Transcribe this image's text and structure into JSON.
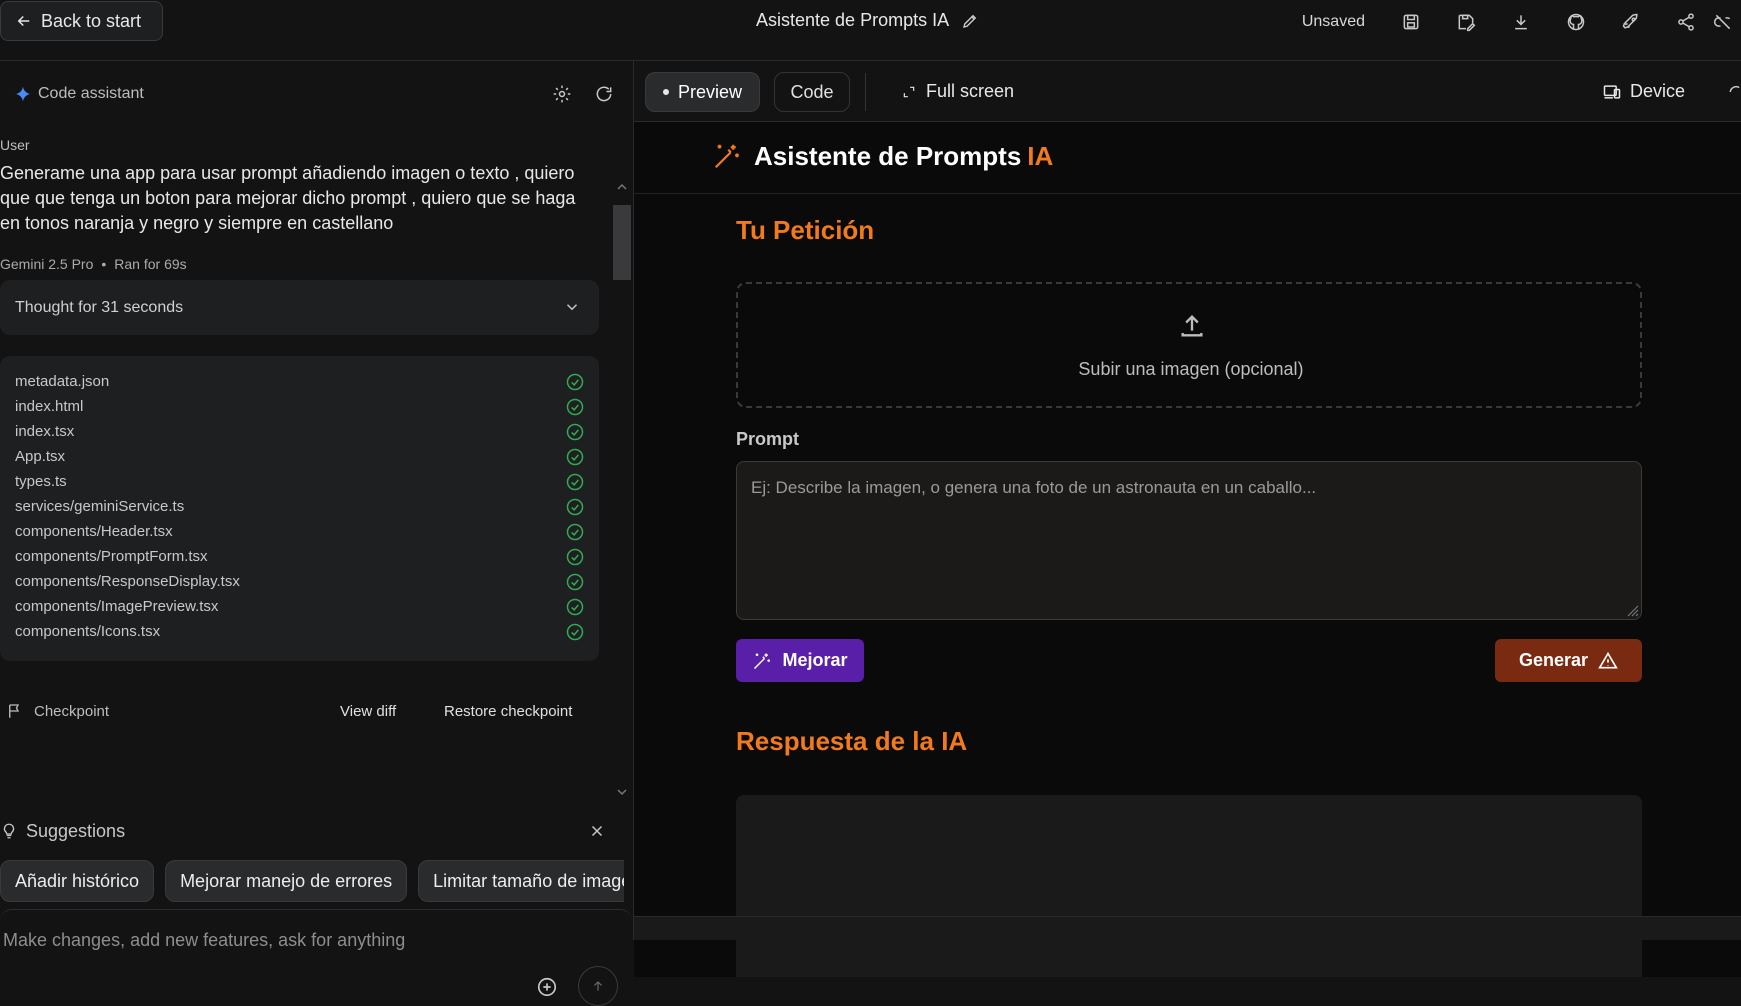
{
  "topbar": {
    "back_label": "Back to start",
    "title": "Asistente de Prompts IA",
    "unsaved": "Unsaved",
    "icons": [
      "save-icon",
      "save-as-icon",
      "download-icon",
      "github-icon",
      "deploy-rocket-icon",
      "share-icon",
      "link-off-icon"
    ]
  },
  "assistant": {
    "title": "Code assistant",
    "user_label": "User",
    "user_message": "Generame una app para usar prompt añadiendo imagen o texto , quiero que que tenga un boton para mejorar dicho prompt , quiero que se haga en tonos naranja y negro y siempre en castellano",
    "model": "Gemini 2.5 Pro",
    "ran_for": "Ran for 69s",
    "thought": "Thought for 31 seconds",
    "files": [
      "metadata.json",
      "index.html",
      "index.tsx",
      "App.tsx",
      "types.ts",
      "services/geminiService.ts",
      "components/Header.tsx",
      "components/PromptForm.tsx",
      "components/ResponseDisplay.tsx",
      "components/ImagePreview.tsx",
      "components/Icons.tsx"
    ],
    "checkpoint": {
      "label": "Checkpoint",
      "view_diff": "View diff",
      "restore": "Restore checkpoint"
    },
    "suggestions": {
      "title": "Suggestions",
      "chips": [
        "Añadir histórico",
        "Mejorar manejo de errores",
        "Limitar tamaño de imagen"
      ]
    },
    "input_placeholder": "Make changes, add new features, ask for anything"
  },
  "preview": {
    "tabs": {
      "preview": "Preview",
      "code": "Code"
    },
    "fullscreen": "Full screen",
    "device": "Device",
    "app": {
      "brand": "Asistente de Prompts",
      "brand_accent": "IA",
      "request_title": "Tu Petición",
      "upload_text": "Subir una imagen (opcional)",
      "prompt_label": "Prompt",
      "prompt_placeholder": "Ej: Describe la imagen, o genera una foto de un astronauta en un caballo...",
      "improve_button": "Mejorar",
      "generate_button": "Generar",
      "response_title": "Respuesta de la IA"
    }
  },
  "colors": {
    "accent_orange": "#f07a1c",
    "improve_purple": "#5a1fa8",
    "generate_brown": "#7a2a10",
    "success_green": "#34a853",
    "assistant_star": "#4a8af4"
  }
}
